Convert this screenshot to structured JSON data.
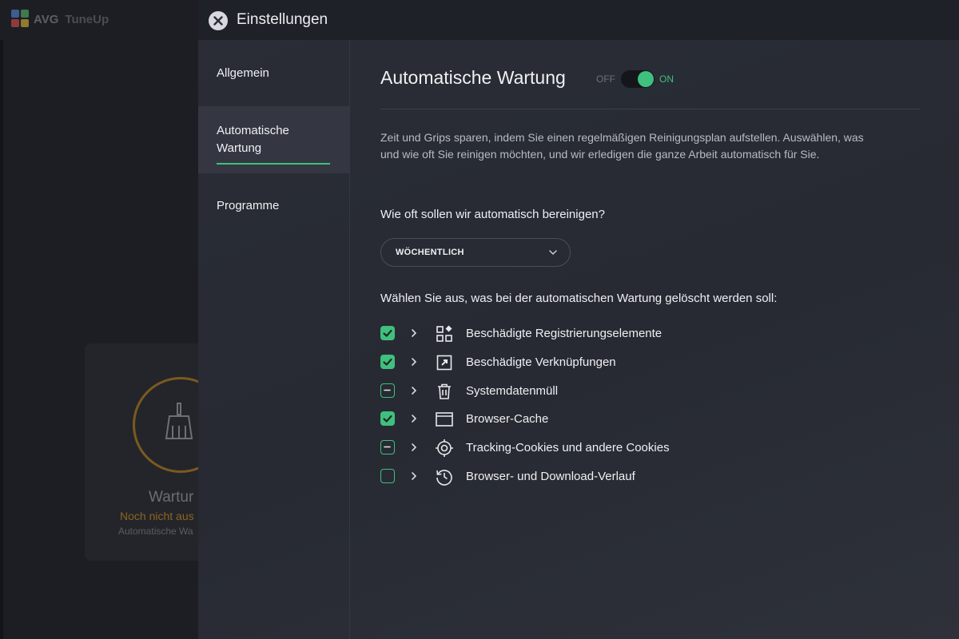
{
  "background_app": {
    "title": "AVG",
    "subtitle": "TuneUp",
    "card_title": "Wartur",
    "card_status": "Noch nicht aus",
    "card_caption": "Automatische Wa"
  },
  "header": {
    "title": "Einstellungen"
  },
  "nav": {
    "items": [
      {
        "label": "Allgemein"
      },
      {
        "label": "Automatische\nWartung",
        "active": true
      },
      {
        "label": "Programme"
      }
    ]
  },
  "section": {
    "title": "Automatische Wartung",
    "toggle_off": "OFF",
    "toggle_on": "ON",
    "description": "Zeit und Grips sparen, indem Sie einen regelmäßigen Reinigungsplan aufstellen. Auswählen, was und wie oft Sie reinigen möchten, und wir erledigen die ganze Arbeit automatisch für Sie.",
    "frequency_question": "Wie oft sollen wir automatisch bereinigen?",
    "frequency_value": "WÖCHENTLICH",
    "items_question": "Wählen Sie aus, was bei der automatischen Wartung gelöscht werden soll:",
    "items": [
      {
        "label": "Beschädigte Registrierungselemente",
        "state": "checked",
        "icon": "registry-icon"
      },
      {
        "label": "Beschädigte Verknüpfungen",
        "state": "checked",
        "icon": "shortcut-icon"
      },
      {
        "label": "Systemdatenmüll",
        "state": "partial",
        "icon": "trash-icon"
      },
      {
        "label": "Browser-Cache",
        "state": "checked",
        "icon": "browser-window-icon"
      },
      {
        "label": "Tracking-Cookies und andere Cookies",
        "state": "partial",
        "icon": "target-icon"
      },
      {
        "label": "Browser- und Download-Verlauf",
        "state": "unchecked",
        "icon": "history-icon"
      }
    ]
  },
  "colors": {
    "accent": "#3fc07e",
    "panel": "#2a2d36",
    "header": "#1f2128"
  }
}
